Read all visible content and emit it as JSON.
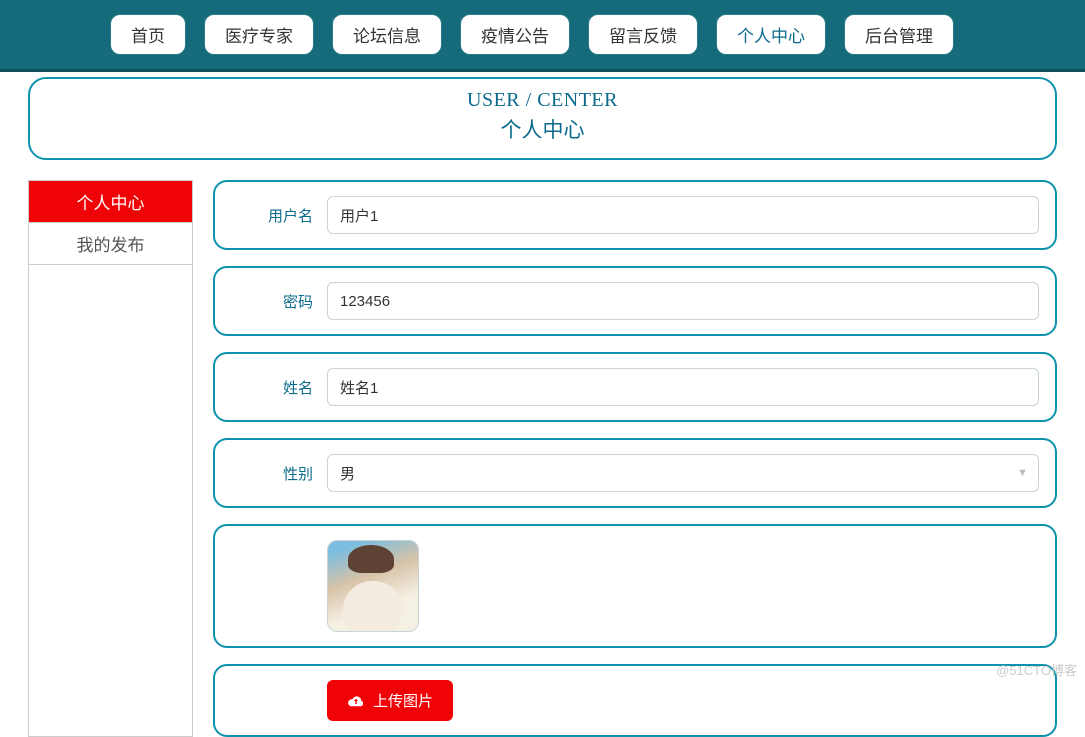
{
  "nav": {
    "items": [
      {
        "label": "首页",
        "active": false
      },
      {
        "label": "医疗专家",
        "active": false
      },
      {
        "label": "论坛信息",
        "active": false
      },
      {
        "label": "疫情公告",
        "active": false
      },
      {
        "label": "留言反馈",
        "active": false
      },
      {
        "label": "个人中心",
        "active": true
      },
      {
        "label": "后台管理",
        "active": false
      }
    ]
  },
  "header": {
    "title_en": "USER / CENTER",
    "title_cn": "个人中心"
  },
  "sidebar": {
    "items": [
      {
        "label": "个人中心",
        "active": true
      },
      {
        "label": "我的发布",
        "active": false
      }
    ]
  },
  "form": {
    "username": {
      "label": "用户名",
      "value": "用户1"
    },
    "password": {
      "label": "密码",
      "value": "123456"
    },
    "name": {
      "label": "姓名",
      "value": "姓名1"
    },
    "gender": {
      "label": "性别",
      "value": "男"
    },
    "upload_label": "上传图片"
  },
  "watermark": "@51CTO博客"
}
